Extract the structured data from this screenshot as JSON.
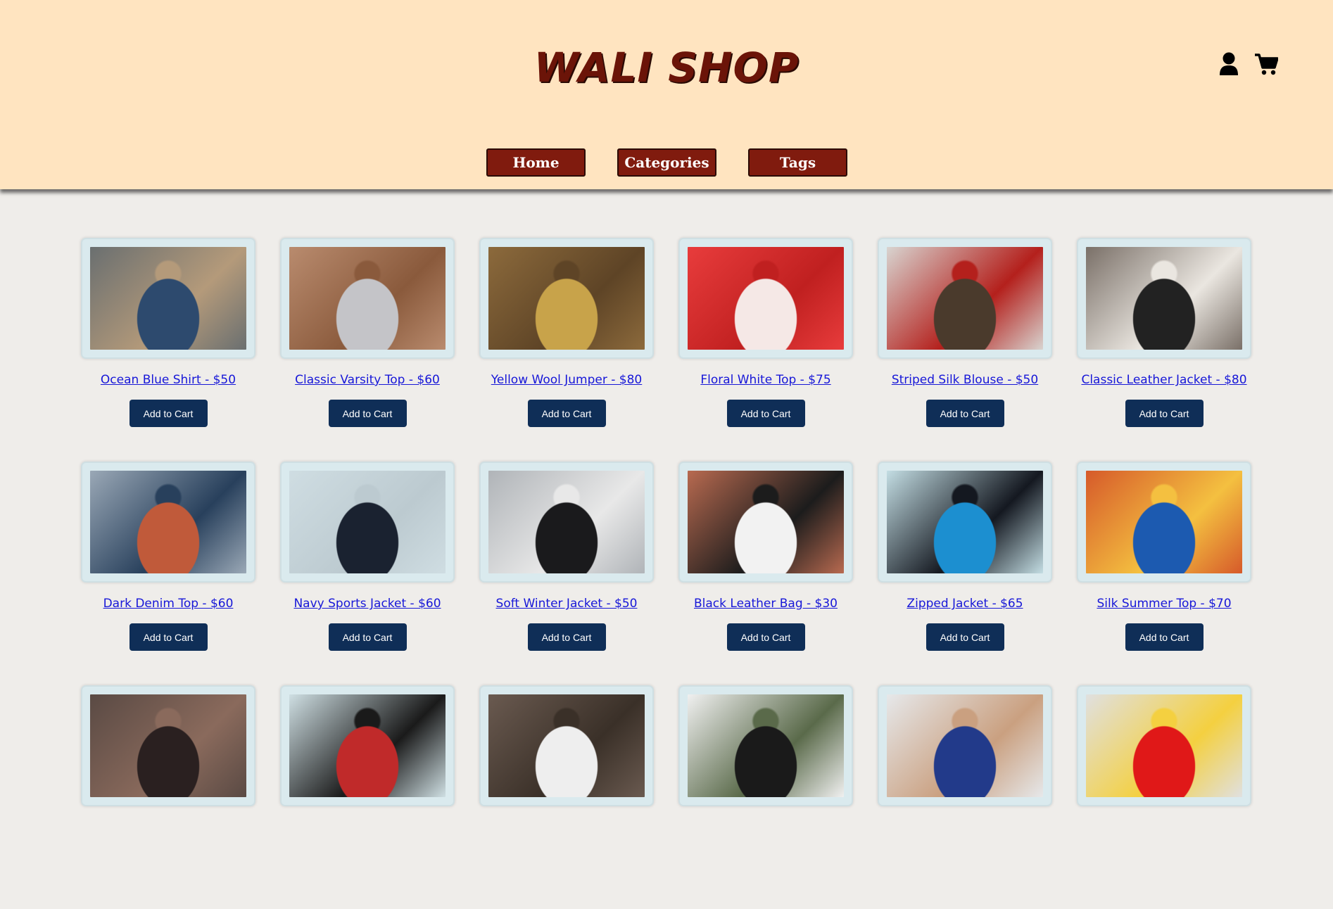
{
  "header": {
    "logo": "WALI SHOP",
    "icons": [
      "user-icon",
      "cart-icon"
    ],
    "nav": [
      {
        "label": "Home"
      },
      {
        "label": "Categories"
      },
      {
        "label": "Tags"
      }
    ]
  },
  "products": [
    {
      "name": "Ocean Blue Shirt - $50",
      "button": "Add to Cart",
      "colors": [
        "#6a6f70",
        "#2d4a6e",
        "#b49a7a"
      ]
    },
    {
      "name": "Classic Varsity Top - $60",
      "button": "Add to Cart",
      "colors": [
        "#b98b6e",
        "#c4c4c8",
        "#8a5a3c"
      ]
    },
    {
      "name": "Yellow Wool Jumper - $80",
      "button": "Add to Cart",
      "colors": [
        "#8c6a3c",
        "#c8a34a",
        "#5e4426"
      ]
    },
    {
      "name": "Floral White Top - $75",
      "button": "Add to Cart",
      "colors": [
        "#e83c3c",
        "#f5e8e6",
        "#c02020"
      ]
    },
    {
      "name": "Striped Silk Blouse - $50",
      "button": "Add to Cart",
      "colors": [
        "#d8d4d0",
        "#4a3a2c",
        "#b4201c"
      ]
    },
    {
      "name": "Classic Leather Jacket - $80",
      "button": "Add to Cart",
      "colors": [
        "#7a7068",
        "#222222",
        "#eae6e0"
      ]
    },
    {
      "name": "Dark Denim Top - $60",
      "button": "Add to Cart",
      "colors": [
        "#9aa8b6",
        "#c05a3a",
        "#28405c"
      ]
    },
    {
      "name": "Navy Sports Jacket - $60",
      "button": "Add to Cart",
      "colors": [
        "#cfdde2",
        "#1a2230",
        "#bccad0"
      ]
    },
    {
      "name": "Soft Winter Jacket - $50",
      "button": "Add to Cart",
      "colors": [
        "#b0b4b8",
        "#1a1a1c",
        "#e8e8e8"
      ]
    },
    {
      "name": "Black Leather Bag - $30",
      "button": "Add to Cart",
      "colors": [
        "#b86a50",
        "#f2f2f2",
        "#1c1c1c"
      ]
    },
    {
      "name": "Zipped Jacket - $65",
      "button": "Add to Cart",
      "colors": [
        "#c3dde3",
        "#1c8fd0",
        "#141820"
      ]
    },
    {
      "name": "Silk Summer Top - $70",
      "button": "Add to Cart",
      "colors": [
        "#d65a2a",
        "#1c5ab0",
        "#f4c040"
      ]
    },
    {
      "name": "",
      "button": "",
      "colors": [
        "#5a4a44",
        "#2a2020",
        "#8a6a5c"
      ]
    },
    {
      "name": "",
      "button": "",
      "colors": [
        "#cfdfe3",
        "#c02a2a",
        "#1a1a1a"
      ]
    },
    {
      "name": "",
      "button": "",
      "colors": [
        "#6a5a50",
        "#eeeeee",
        "#3a3028"
      ]
    },
    {
      "name": "",
      "button": "",
      "colors": [
        "#f0f0f0",
        "#1a1a1a",
        "#5a6a4a"
      ]
    },
    {
      "name": "",
      "button": "",
      "colors": [
        "#e6e8ea",
        "#223a8a",
        "#caa080"
      ]
    },
    {
      "name": "",
      "button": "",
      "colors": [
        "#e0e0e0",
        "#e01818",
        "#f4d040"
      ]
    }
  ],
  "theme": {
    "header_bg": "#ffe4c0",
    "nav_button_bg": "#801b0e",
    "logo_color": "#6b1408",
    "cart_button_bg": "#0f2e57",
    "link_color": "#1717d8",
    "page_bg": "#efedea"
  }
}
